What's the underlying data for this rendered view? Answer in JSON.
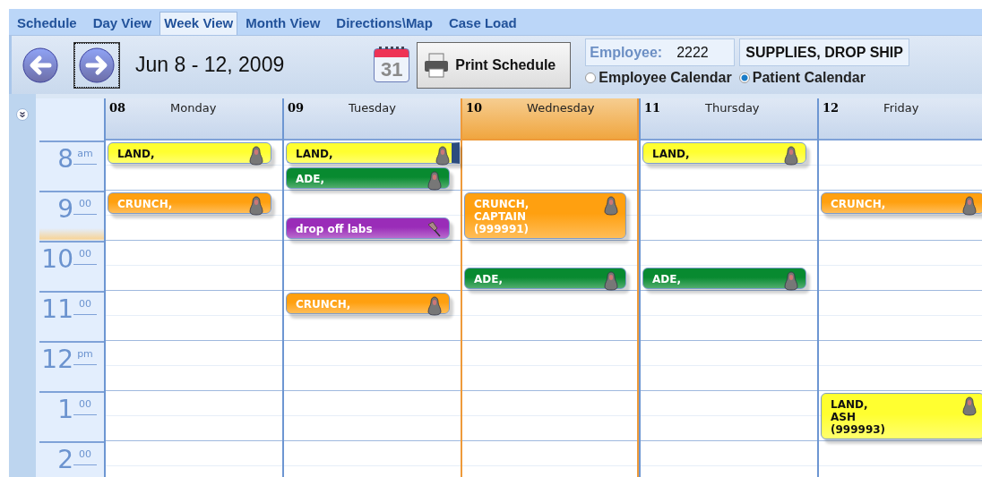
{
  "tabs": [
    {
      "label": "Schedule",
      "selected": false
    },
    {
      "label": "Day View",
      "selected": false
    },
    {
      "label": "Week View",
      "selected": true
    },
    {
      "label": "Month View",
      "selected": false
    },
    {
      "label": "Directions\\Map",
      "selected": false
    },
    {
      "label": "Case Load",
      "selected": false
    }
  ],
  "toolbar": {
    "date_range": "Jun 8 - 12, 2009",
    "calendar_icon_day": "31",
    "print_button": "Print Schedule",
    "employee_label": "Employee:",
    "employee_id": "2222",
    "employee_name": "SUPPLIES, DROP SHIP",
    "calendar_options": [
      {
        "label": "Employee Calendar",
        "selected": false
      },
      {
        "label": "Patient Calendar",
        "selected": true
      }
    ]
  },
  "days": [
    {
      "number": "08",
      "name": "Monday",
      "today": false
    },
    {
      "number": "09",
      "name": "Tuesday",
      "today": false
    },
    {
      "number": "10",
      "name": "Wednesday",
      "today": true
    },
    {
      "number": "11",
      "name": "Thursday",
      "today": false
    },
    {
      "number": "12",
      "name": "Friday",
      "today": false
    }
  ],
  "hours": [
    {
      "hour": "8",
      "suffix": "am",
      "now": false,
      "mon": [
        {
          "kind": "patient",
          "lines": [
            "LAND,"
          ],
          "half_past": false,
          "long": false,
          "color": "#ffff30",
          "selected": false
        }
      ],
      "tue": [
        {
          "kind": "patient",
          "lines": [
            "LAND,"
          ],
          "half_past": false,
          "long": false,
          "color": "#ffff30",
          "selected": true
        },
        {
          "kind": "patient",
          "lines": [
            "ADE,"
          ],
          "half_past": true,
          "long": false,
          "color": "#088a30",
          "selected": false
        }
      ],
      "thu": [
        {
          "kind": "patient",
          "lines": [
            "LAND,"
          ],
          "half_past": false,
          "long": false,
          "color": "#ffff30",
          "selected": false
        }
      ]
    },
    {
      "hour": "9",
      "suffix": "00",
      "now": true,
      "mon": [
        {
          "kind": "patient",
          "lines": [
            "CRUNCH,"
          ],
          "half_past": false,
          "long": false,
          "color": "#ffa010",
          "selected": false
        }
      ],
      "tue": [
        {
          "kind": "task",
          "lines": [
            "drop off labs"
          ],
          "half_past": true,
          "long": false,
          "color": "#9a2cb8",
          "selected": false
        }
      ],
      "wed": [
        {
          "kind": "patient",
          "lines": [
            "CRUNCH,",
            "CAPTAIN",
            "(999991)"
          ],
          "half_past": false,
          "long": true,
          "color": "#ffa010",
          "selected": false
        }
      ],
      "fri": [
        {
          "kind": "patient",
          "lines": [
            "CRUNCH,"
          ],
          "half_past": false,
          "long": false,
          "color": "#ffa010",
          "selected": false
        }
      ]
    },
    {
      "hour": "10",
      "suffix": "00",
      "now": false,
      "wed": [
        {
          "kind": "patient",
          "lines": [
            "ADE,"
          ],
          "half_past": true,
          "long": false,
          "color": "#088a30",
          "selected": false
        }
      ],
      "thu": [
        {
          "kind": "patient",
          "lines": [
            "ADE,"
          ],
          "half_past": true,
          "long": false,
          "color": "#088a30",
          "selected": false
        }
      ]
    },
    {
      "hour": "11",
      "suffix": "00",
      "now": false,
      "tue": [
        {
          "kind": "patient",
          "lines": [
            "CRUNCH,"
          ],
          "half_past": false,
          "long": false,
          "color": "#ffa010",
          "selected": false
        }
      ]
    },
    {
      "hour": "12",
      "suffix": "pm",
      "now": false
    },
    {
      "hour": "1",
      "suffix": "00",
      "now": false,
      "fri": [
        {
          "kind": "patient",
          "lines": [
            "LAND,",
            "ASH",
            "(999993)"
          ],
          "half_past": false,
          "long": true,
          "color": "#ffff30",
          "selected": false
        }
      ]
    },
    {
      "hour": "2",
      "suffix": "00",
      "now": false
    }
  ]
}
